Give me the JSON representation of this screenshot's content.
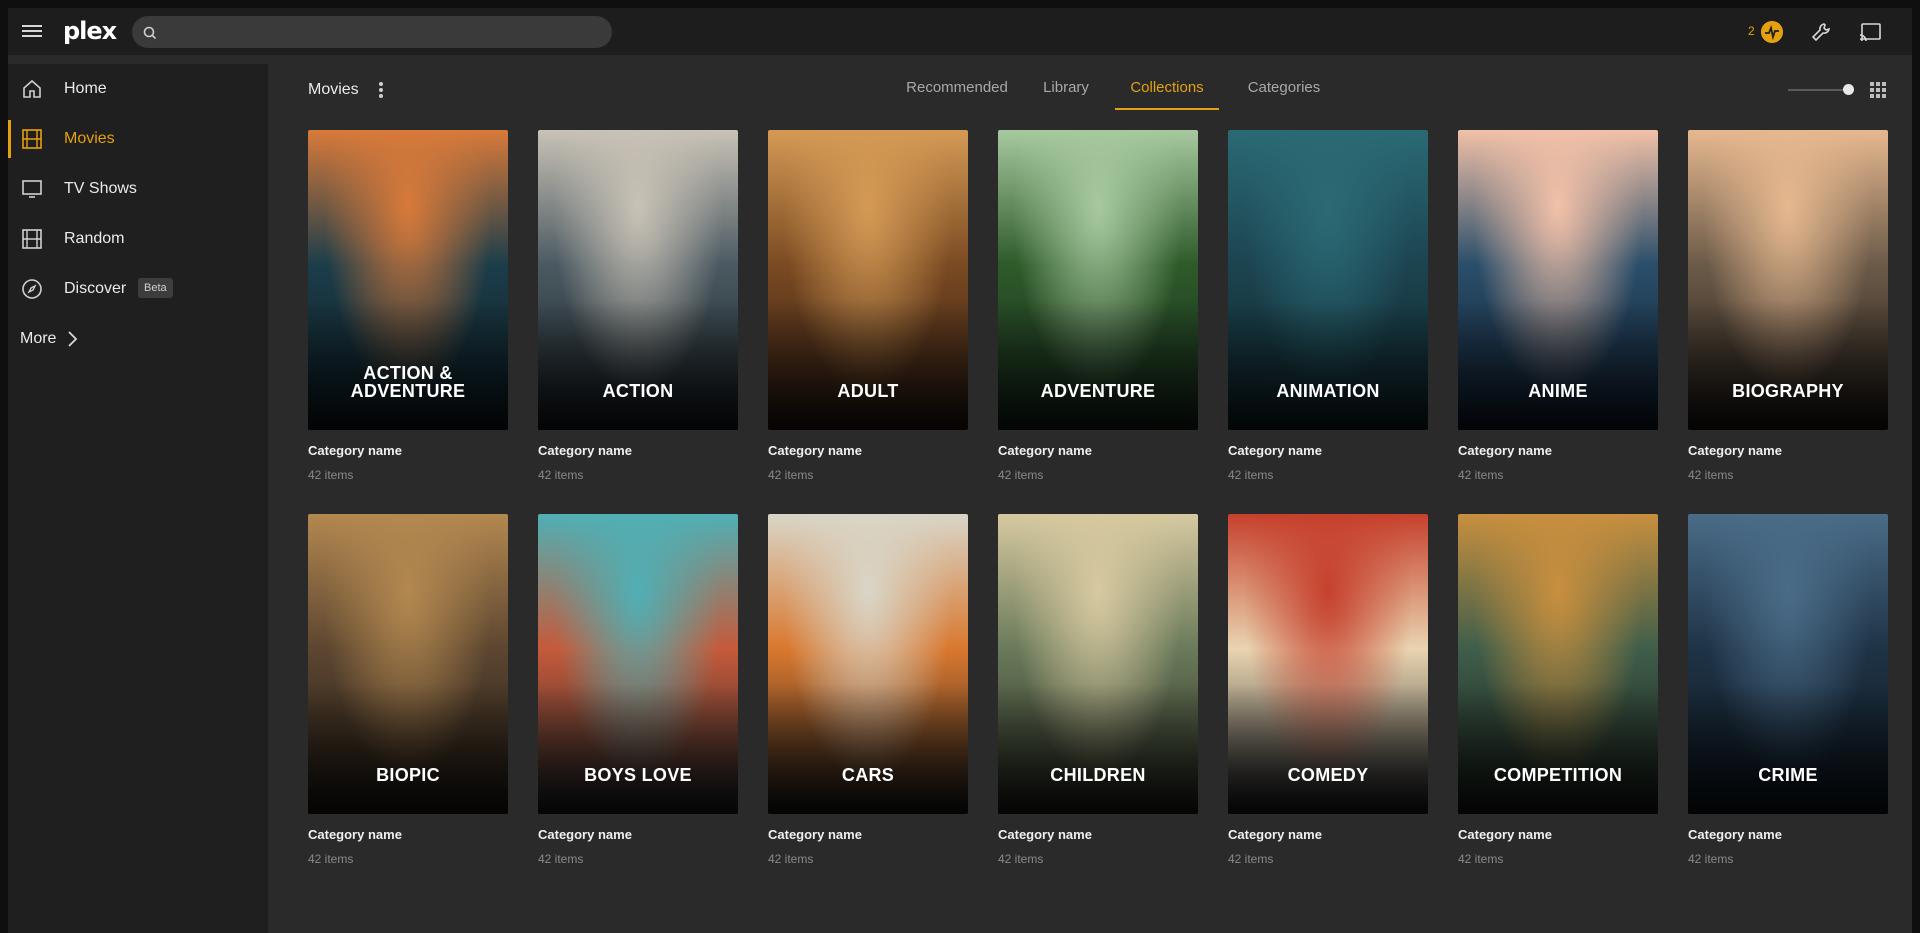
{
  "app": {
    "logo_text": "plex",
    "brand_color": "#e5a00d"
  },
  "topbar": {
    "search_placeholder": "",
    "activity_count": "2",
    "icons": [
      "menu-icon",
      "search-icon",
      "activity-icon",
      "settings-icon",
      "cast-icon"
    ]
  },
  "sidebar": {
    "items": [
      {
        "label": "Home",
        "icon": "home-icon"
      },
      {
        "label": "Movies",
        "icon": "film-icon",
        "active": true
      },
      {
        "label": "TV Shows",
        "icon": "tv-icon"
      },
      {
        "label": "Random",
        "icon": "film-icon"
      },
      {
        "label": "Discover",
        "icon": "compass-icon",
        "badge": "Beta"
      },
      {
        "label": "More",
        "icon": "chevron-right-icon"
      }
    ]
  },
  "header": {
    "section_title": "Movies",
    "tabs": [
      "Recommended",
      "Library",
      "Collections",
      "Categories"
    ],
    "active_tab": "Collections",
    "zoom_level": 1.0
  },
  "collections": [
    {
      "title": "ACTION & ADVENTURE",
      "name": "Category name",
      "count": "42 items",
      "colors": [
        "#d87a3a",
        "#1c3d4a",
        "#0b1a20"
      ]
    },
    {
      "title": "ACTION",
      "name": "Category name",
      "count": "42 items",
      "colors": [
        "#c9c2b6",
        "#4b5a62",
        "#141b20"
      ]
    },
    {
      "title": "ADULT",
      "name": "Category name",
      "count": "42 items",
      "colors": [
        "#d49a55",
        "#7a4a22",
        "#2a1a12"
      ]
    },
    {
      "title": "ADVENTURE",
      "name": "Category name",
      "count": "42 items",
      "colors": [
        "#a7c9a0",
        "#2e5a2a",
        "#14261a"
      ]
    },
    {
      "title": "ANIMATION",
      "name": "Category name",
      "count": "42 items",
      "colors": [
        "#2a6a75",
        "#1c4450",
        "#0f242a"
      ]
    },
    {
      "title": "ANIME",
      "name": "Category name",
      "count": "42 items",
      "colors": [
        "#f2c1a8",
        "#2a4e6a",
        "#0f1d2e"
      ]
    },
    {
      "title": "BIOGRAPHY",
      "name": "Category name",
      "count": "42 items",
      "colors": [
        "#e6b88f",
        "#6b5a48",
        "#1f1a16"
      ]
    },
    {
      "title": "BIOPIC",
      "name": "Category name",
      "count": "42 items",
      "colors": [
        "#b38850",
        "#5c4630",
        "#1c1712"
      ]
    },
    {
      "title": "BOYS LOVE",
      "name": "Category name",
      "count": "42 items",
      "colors": [
        "#4fb0b5",
        "#c55a3a",
        "#1a2326"
      ]
    },
    {
      "title": "CARS",
      "name": "Category name",
      "count": "42 items",
      "colors": [
        "#d9d6c8",
        "#d9782f",
        "#1d1c1a"
      ]
    },
    {
      "title": "CHILDREN",
      "name": "Category name",
      "count": "42 items",
      "colors": [
        "#d7c9a0",
        "#6a7a5a",
        "#22241c"
      ]
    },
    {
      "title": "COMEDY",
      "name": "Category name",
      "count": "42 items",
      "colors": [
        "#c6402c",
        "#e9d4b0",
        "#1a1e22"
      ]
    },
    {
      "title": "COMPETITION",
      "name": "Category name",
      "count": "42 items",
      "colors": [
        "#c88f3e",
        "#3f5e4a",
        "#151a16"
      ]
    },
    {
      "title": "CRIME",
      "name": "Category name",
      "count": "42 items",
      "colors": [
        "#4a6c88",
        "#1f3346",
        "#0b141c"
      ]
    }
  ]
}
